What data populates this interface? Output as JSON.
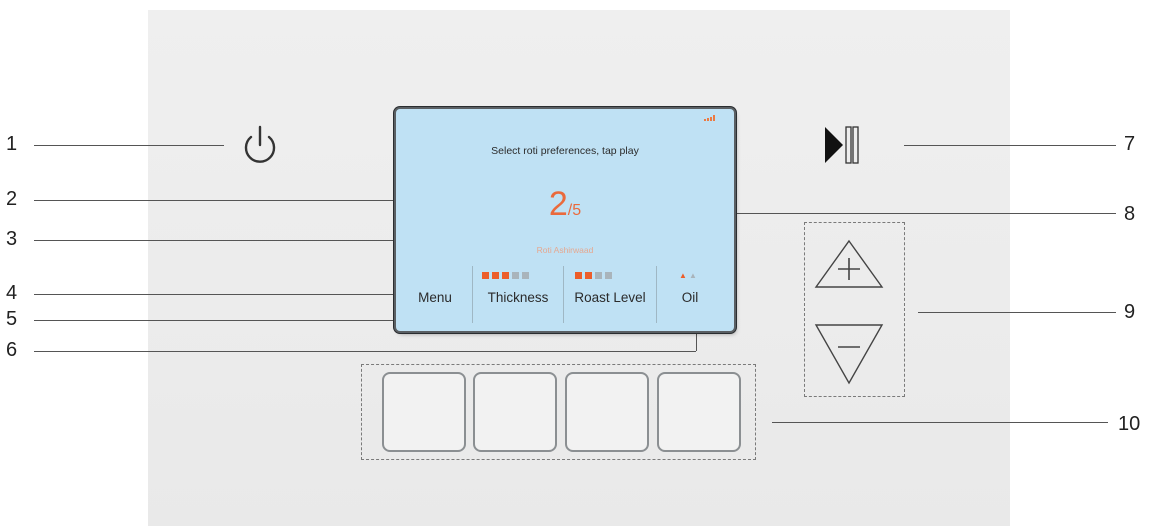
{
  "screen": {
    "prompt": "Select roti preferences, tap play",
    "count_current": "2",
    "count_separator": "/",
    "count_total": "5",
    "roti_type": "Roti Ashirwaad",
    "options": [
      {
        "label": "Menu"
      },
      {
        "label": "Thickness",
        "level": 3,
        "max": 5
      },
      {
        "label": "Roast Level",
        "level": 2,
        "max": 4
      },
      {
        "label": "Oil",
        "level": 1,
        "max": 2
      }
    ]
  },
  "callouts": [
    "1",
    "2",
    "3",
    "4",
    "5",
    "6",
    "7",
    "8",
    "9",
    "10"
  ],
  "icons": {
    "power": "power-icon",
    "play_pause": "play-pause-icon",
    "plus": "plus-icon",
    "minus": "minus-icon",
    "signal": "signal-icon",
    "oil": "oil-drop-icon"
  },
  "colors": {
    "screen_bg": "#bfe1f4",
    "accent": "#ec5d2a",
    "level_off": "#a9b4bb",
    "panel": "#ececec"
  }
}
